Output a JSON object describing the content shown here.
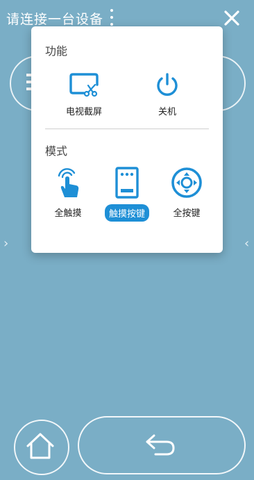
{
  "header": {
    "title": "请连接一台设备"
  },
  "menu": {
    "section_function": "功能",
    "function_items": [
      {
        "label": "电视截屏",
        "icon": "tv-screenshot-icon"
      },
      {
        "label": "关机",
        "icon": "power-icon"
      }
    ],
    "section_mode": "模式",
    "mode_items": [
      {
        "label": "全触摸",
        "icon": "touch-icon"
      },
      {
        "label": "触摸按键",
        "icon": "remote-keys-icon",
        "selected": true
      },
      {
        "label": "全按键",
        "icon": "dpad-icon"
      }
    ]
  },
  "colors": {
    "background": "#7aaec6",
    "accent": "#1e8fd6",
    "menu_bg": "#ffffff"
  }
}
